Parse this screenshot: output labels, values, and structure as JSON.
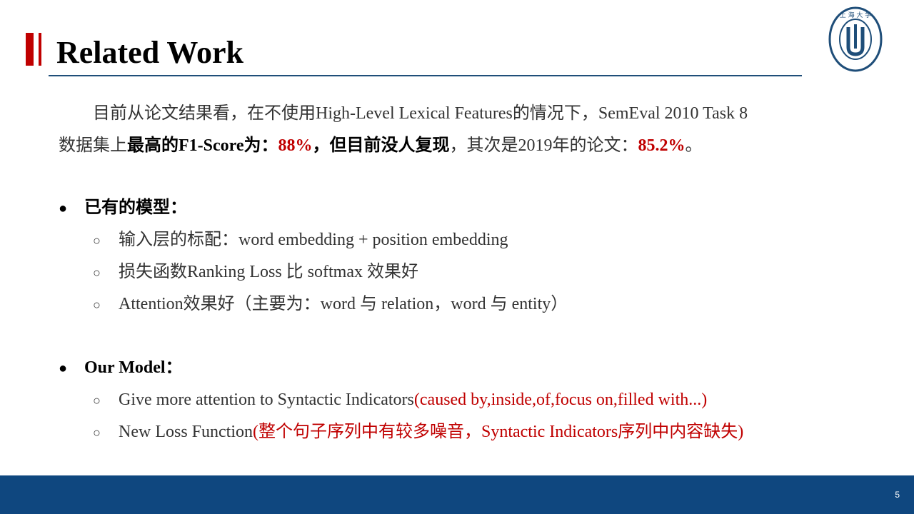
{
  "slide": {
    "title": "Related Work",
    "page_number": "5",
    "logo_text": "SHANGHAI UNIVERSITY",
    "colors": {
      "accent_red": "#c00000",
      "footer_blue": "#0f477f",
      "rule_blue": "#1f4e79"
    }
  },
  "intro": {
    "p1": "目前从论文结果看，在不使用High-Level Lexical Features的情况下，SemEval 2010 Task 8",
    "p2a": "数据集上",
    "p2b": "最高的F1-Score为：",
    "p2c": "88%",
    "p2d": "，但目前没人复现",
    "p2e": "，其次是2019年的论文：",
    "p2f": "85.2%",
    "p2g": "。"
  },
  "existing": {
    "heading": "已有的模型：",
    "items": [
      "输入层的标配：word embedding + position embedding",
      "损失函数Ranking Loss 比 softmax 效果好",
      "Attention效果好（主要为：word 与 relation，word 与 entity）"
    ]
  },
  "ours": {
    "heading": "Our Model：",
    "item1_black": "Give more attention to Syntactic Indicators",
    "item1_red": "(caused by,inside,of,focus on,filled with...)",
    "item2_black": "New Loss Function",
    "item2_red": "(整个句子序列中有较多噪音，Syntactic Indicators序列中内容缺失)"
  }
}
